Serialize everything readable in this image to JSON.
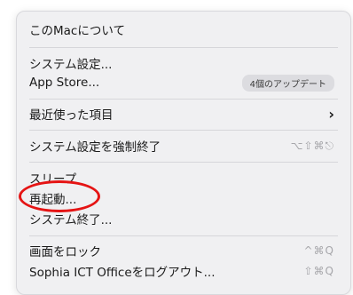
{
  "menu": {
    "items": [
      {
        "label": "このMacについて"
      },
      {
        "label": "システム設定..."
      },
      {
        "label": "App Store...",
        "badge": "4個のアップデート"
      },
      {
        "label": "最近使った項目",
        "submenu_glyph": "›"
      },
      {
        "label": "システム設定を強制終了",
        "shortcut": "⌥⇧⌘⎋"
      },
      {
        "label": "スリープ"
      },
      {
        "label": "再起動..."
      },
      {
        "label": "システム終了..."
      },
      {
        "label": "画面をロック",
        "shortcut": "^⌘Q"
      },
      {
        "label": "Sophia ICT Officeをログアウト...",
        "shortcut": "⇧⌘Q"
      }
    ]
  },
  "annotation": {
    "color": "#e51414",
    "target": "再起動..."
  }
}
